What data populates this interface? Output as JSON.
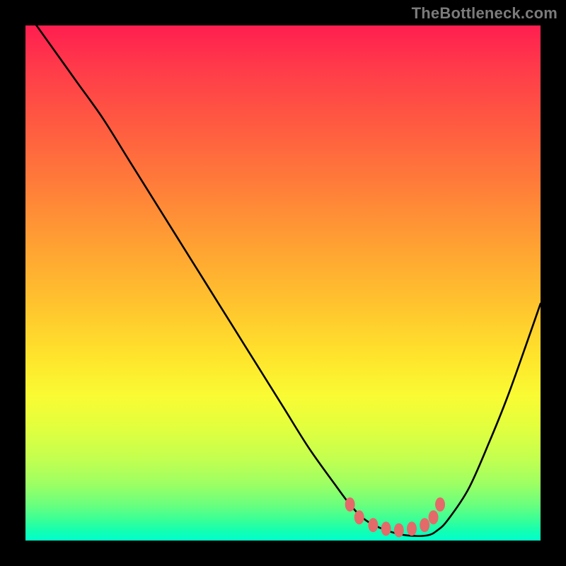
{
  "watermark": "TheBottleneck.com",
  "colors": {
    "curve": "#000000",
    "marker": "#e46a6a",
    "axis_bg": "#000000"
  },
  "chart_data": {
    "type": "line",
    "title": "",
    "xlabel": "",
    "ylabel": "",
    "xlim": [
      0,
      100
    ],
    "ylim": [
      0,
      100
    ],
    "grid": false,
    "series": [
      {
        "name": "bottleneck-curve",
        "x": [
          0,
          5,
          10,
          15,
          20,
          25,
          30,
          35,
          40,
          45,
          50,
          55,
          60,
          63,
          66,
          70,
          74,
          78,
          80,
          82,
          86,
          90,
          94,
          100
        ],
        "y": [
          103,
          96,
          89,
          82,
          74,
          66,
          58,
          50,
          42,
          34,
          26,
          18,
          11,
          7,
          4,
          2,
          1,
          1,
          2,
          4,
          10,
          19,
          29,
          46
        ]
      }
    ],
    "optimal_range": {
      "x_start": 63,
      "x_end": 80,
      "y_level": 3.5
    },
    "markers": [
      {
        "x": 63.0,
        "y": 7.0
      },
      {
        "x": 64.8,
        "y": 4.5
      },
      {
        "x": 67.5,
        "y": 3.0
      },
      {
        "x": 70.0,
        "y": 2.3
      },
      {
        "x": 72.5,
        "y": 2.0
      },
      {
        "x": 75.0,
        "y": 2.3
      },
      {
        "x": 77.5,
        "y": 3.0
      },
      {
        "x": 79.2,
        "y": 4.5
      },
      {
        "x": 80.5,
        "y": 7.0
      }
    ]
  }
}
